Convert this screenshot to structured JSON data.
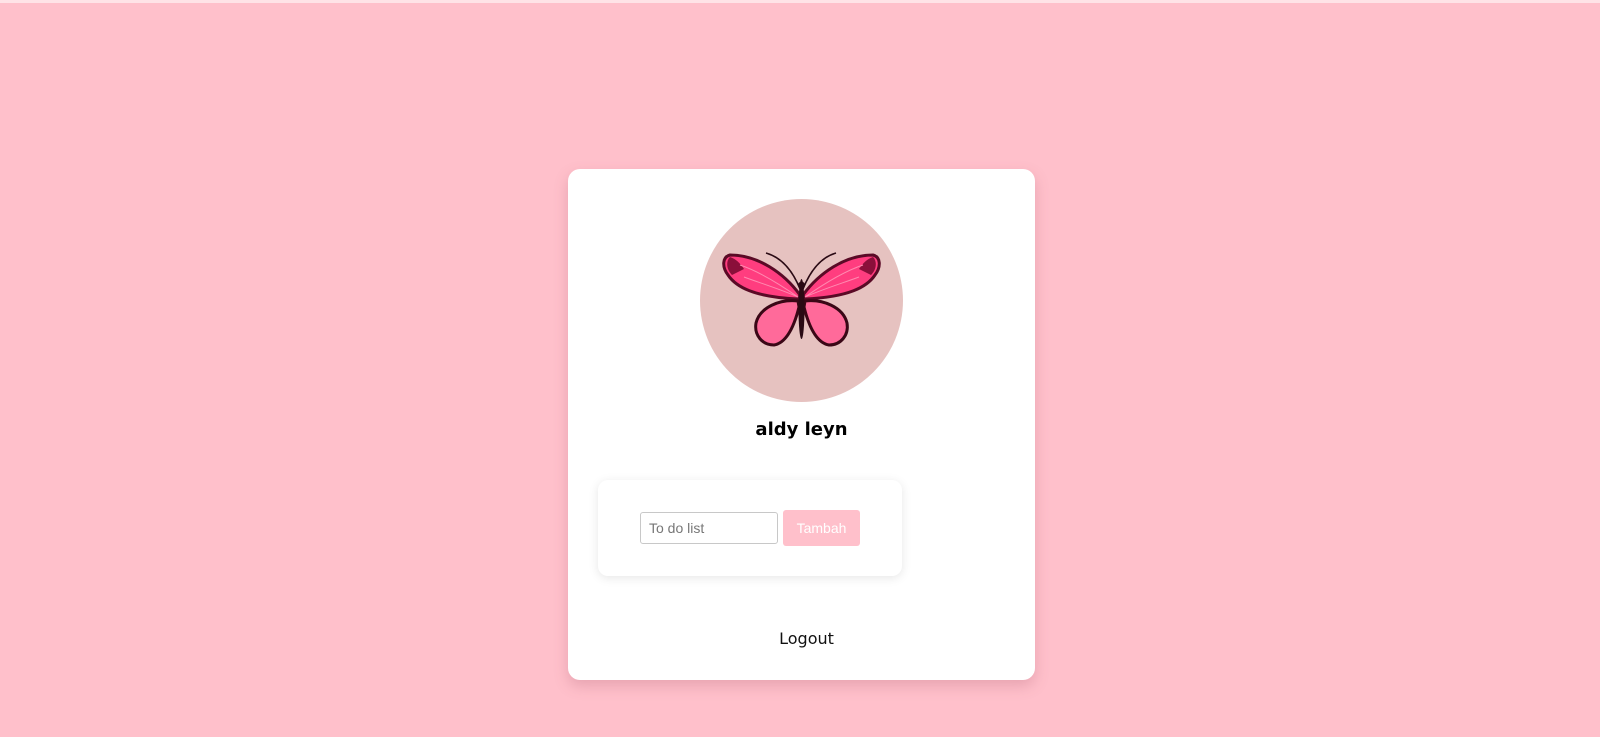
{
  "profile": {
    "username": "aldy leyn",
    "avatar_icon": "butterfly-icon"
  },
  "todo": {
    "input_value": "",
    "input_placeholder": "To do list",
    "add_label": "Tambah"
  },
  "logout_label": "Logout",
  "colors": {
    "background": "#ffc0cb",
    "card": "#ffffff",
    "avatar_bg": "#e6c2c0",
    "accent": "#ffc0cb",
    "butterfly_wing": "#ff3d7f",
    "butterfly_outline": "#5a0a26"
  }
}
